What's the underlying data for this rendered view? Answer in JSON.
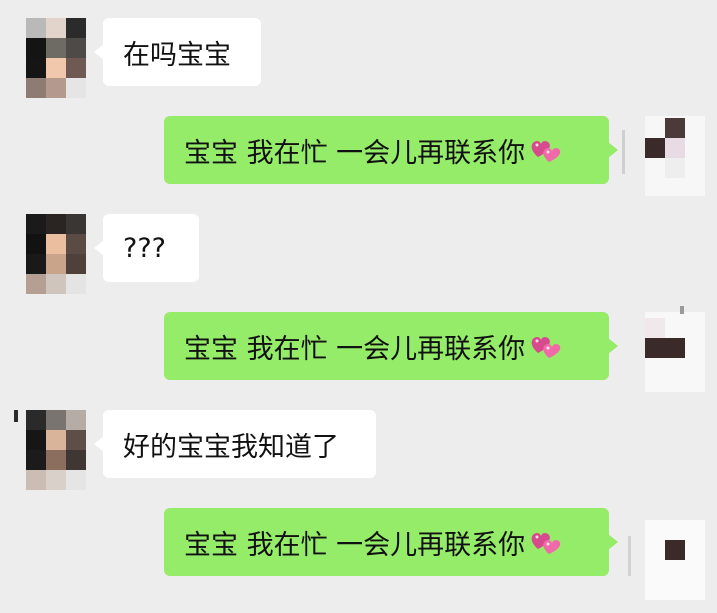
{
  "messages": [
    {
      "side": "incoming",
      "text": "在吗宝宝"
    },
    {
      "side": "outgoing",
      "text": "宝宝 我在忙 一会儿再联系你",
      "emoji": "heart-icon"
    },
    {
      "side": "incoming",
      "text": "???"
    },
    {
      "side": "outgoing",
      "text": "宝宝 我在忙 一会儿再联系你",
      "emoji": "heart-icon"
    },
    {
      "side": "incoming",
      "text": "好的宝宝我知道了"
    },
    {
      "side": "outgoing",
      "text": "宝宝 我在忙 一会儿再联系你",
      "emoji": "heart-icon"
    }
  ],
  "colors": {
    "background": "#ededed",
    "incoming_bubble": "#ffffff",
    "outgoing_bubble": "#95ec69",
    "heart": "#e0408a"
  }
}
